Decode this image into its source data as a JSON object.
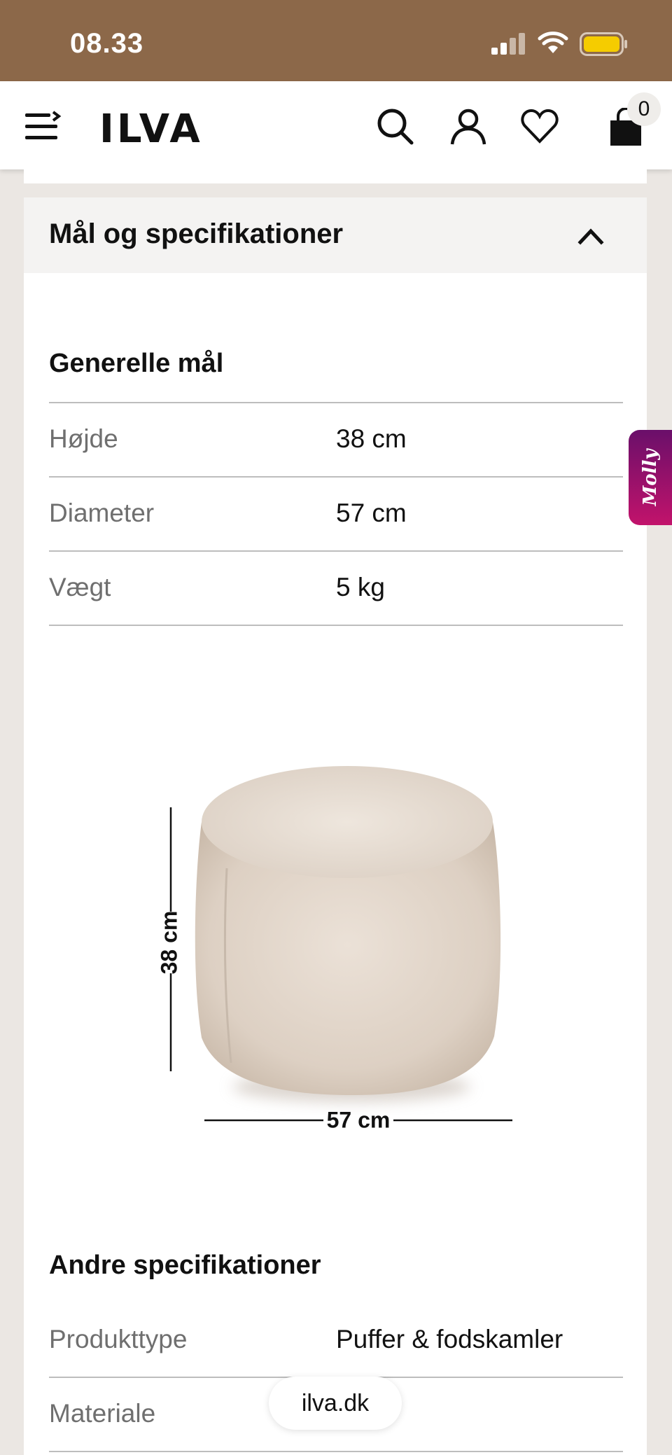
{
  "status_bar": {
    "time": "08.33",
    "icons": [
      "signal-icon",
      "wifi-icon",
      "battery-icon"
    ],
    "battery_color": "#f5cc00"
  },
  "header": {
    "logo": "ILVA",
    "cart_count": "0",
    "icons": [
      "menu-icon",
      "search-icon",
      "account-icon",
      "heart-icon",
      "cart-icon"
    ]
  },
  "accordion": {
    "title": "Mål og specifikationer",
    "expanded": true,
    "general": {
      "title": "Generelle mål",
      "rows": [
        {
          "label": "Højde",
          "value": "38 cm"
        },
        {
          "label": "Diameter",
          "value": "57 cm"
        },
        {
          "label": "Vægt",
          "value": "5 kg"
        }
      ]
    },
    "illustration": {
      "height_label": "38 cm",
      "width_label": "57 cm"
    },
    "other": {
      "title": "Andre specifikationer",
      "rows": [
        {
          "label": "Produkttype",
          "value": "Puffer & fodskamler"
        },
        {
          "label": "Materiale",
          "value": ""
        }
      ]
    }
  },
  "molly_tab": {
    "label": "Molly"
  },
  "browser": {
    "url": "ilva.dk"
  },
  "colors": {
    "status_bar": "#8c6849",
    "page_background": "#ebe7e3",
    "accordion_header": "#f4f3f2",
    "molly_gradient_start": "#6a0f6a",
    "molly_gradient_end": "#c2136b"
  }
}
